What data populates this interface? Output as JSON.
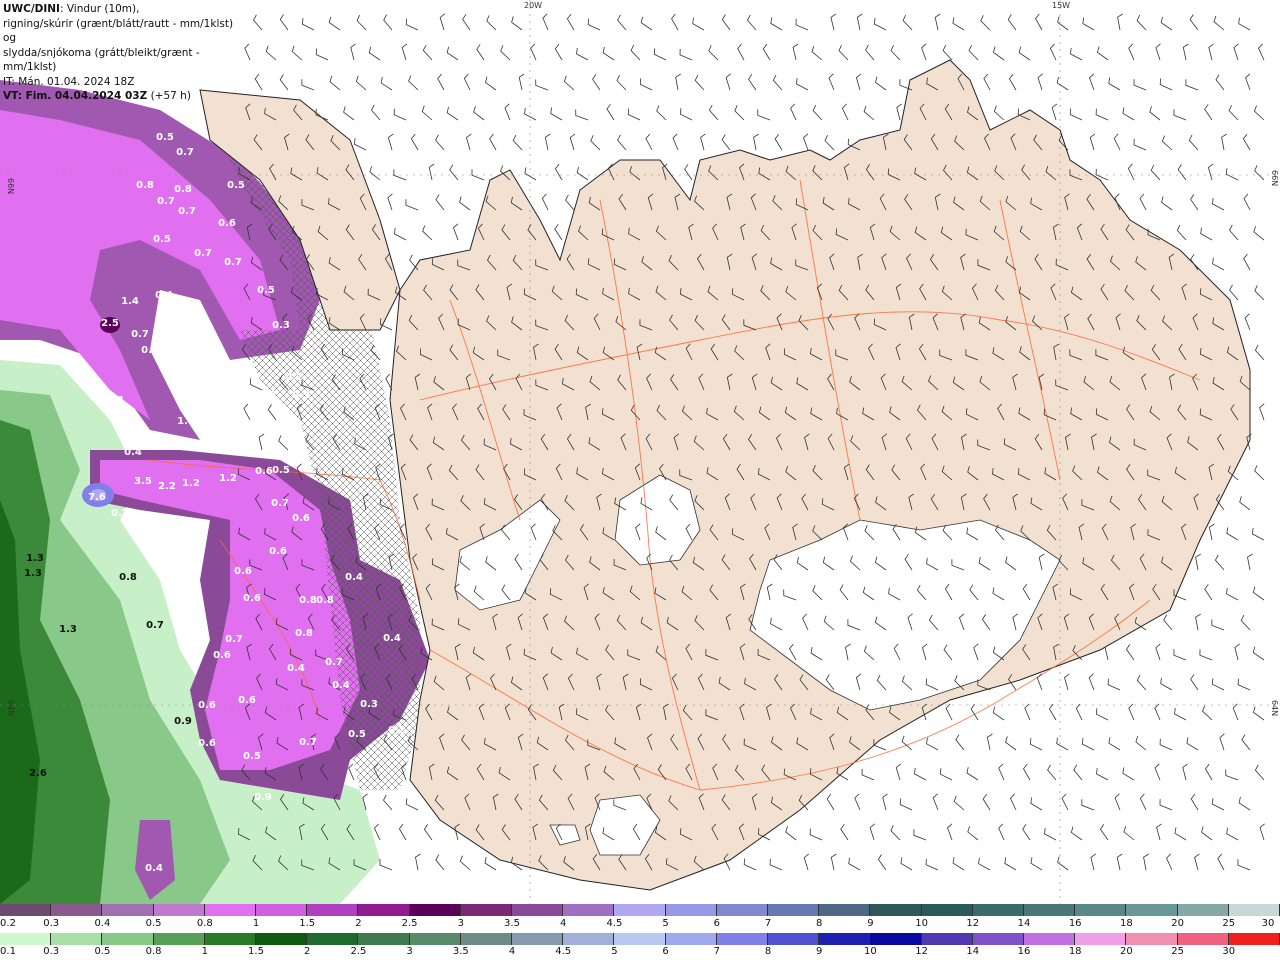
{
  "header": {
    "model": "UWC/DINI",
    "desc_line1": ": Vindur (10m),",
    "desc_line2": "rigning/skúrir (grænt/blátt/rautt - mm/1klst) og",
    "desc_line3": "slydda/snjókoma (grátt/bleikt/grænt - mm/1klst)",
    "it_line": "IT: Mán. 01.04. 2024 18Z",
    "vt_prefix": "VT: Fim. 04.04.2024 03Z",
    "vt_suffix": " (+57 h)"
  },
  "graticule": {
    "lon_top": [
      "20W",
      "15W"
    ],
    "lat_left": [
      "66N",
      "64N"
    ],
    "lat_right": [
      "66N",
      "64N"
    ]
  },
  "map_labels": {
    "snow": [
      "0.5",
      "0.7",
      "0.8",
      "0.8",
      "0.5",
      "0.7",
      "0.7",
      "0.6",
      "0.5",
      "0.7",
      "0.7",
      "0.5",
      "0.3",
      "1.4",
      "0.4",
      "2.5",
      "0.7",
      "0.7",
      "0.4",
      "1.1",
      "1.4",
      "0.2",
      "0.3",
      "0.3",
      "0.6",
      "0.5",
      "3.5",
      "2.2",
      "1.2",
      "1.2",
      "0.7",
      "0.6",
      "0.6",
      "0.6",
      "0.4",
      "0.6",
      "0.8",
      "0.8",
      "0.7",
      "0.8",
      "0.4",
      "0.6",
      "0.4",
      "0.7",
      "0.4",
      "0.6",
      "0.6",
      "0.3",
      "0.7",
      "0.5",
      "0.6",
      "0.5",
      "0.9",
      "0.2",
      "0.4",
      "0.2",
      "7.6",
      "0.4"
    ],
    "rain": [
      "1.3",
      "1.3",
      "0.8",
      "1.3",
      "0.7",
      "0.9",
      "2.6"
    ]
  },
  "legend": {
    "snow_colors": [
      "#6e4a6e",
      "#8a5a8e",
      "#a070b0",
      "#c07ad0",
      "#e070f0",
      "#d060e0",
      "#b040c0",
      "#901c90",
      "#5a0058",
      "#7a2878",
      "#8a4a98",
      "#a070c0",
      "#b0a8f0",
      "#9898e8",
      "#8088d0",
      "#6878b0",
      "#506888",
      "#305858",
      "#2a5a5a",
      "#3a6a6a",
      "#4a7878",
      "#5a8888",
      "#6a9898",
      "#88a8a8",
      "#c8d8d8"
    ],
    "snow_labels": [
      "0.2",
      "0.3",
      "0.4",
      "0.5",
      "0.8",
      "1",
      "1.5",
      "2",
      "2.5",
      "3",
      "3.5",
      "4",
      "4.5",
      "5",
      "6",
      "7",
      "8",
      "9",
      "10",
      "12",
      "14",
      "16",
      "18",
      "20",
      "25",
      "30"
    ],
    "rain_colors": [
      "#d0f8d0",
      "#a8e0a8",
      "#88c888",
      "#58a058",
      "#2a7a2a",
      "#105a10",
      "#206a30",
      "#407a50",
      "#5a8a6a",
      "#708a88",
      "#8898b0",
      "#a0b0d8",
      "#b8c8f0",
      "#a0a8f0",
      "#8080e8",
      "#5050d0",
      "#2020b0",
      "#0808a0",
      "#5038b0",
      "#8050c8",
      "#c070e0",
      "#f0a0e8",
      "#f090b0",
      "#f06080",
      "#f02020"
    ],
    "rain_labels": [
      "0.1",
      "0.3",
      "0.5",
      "0.8",
      "1",
      "1.5",
      "2",
      "2.5",
      "3",
      "3.5",
      "4",
      "4.5",
      "5",
      "6",
      "7",
      "8",
      "9",
      "10",
      "12",
      "14",
      "16",
      "18",
      "20",
      "25",
      "30"
    ]
  }
}
